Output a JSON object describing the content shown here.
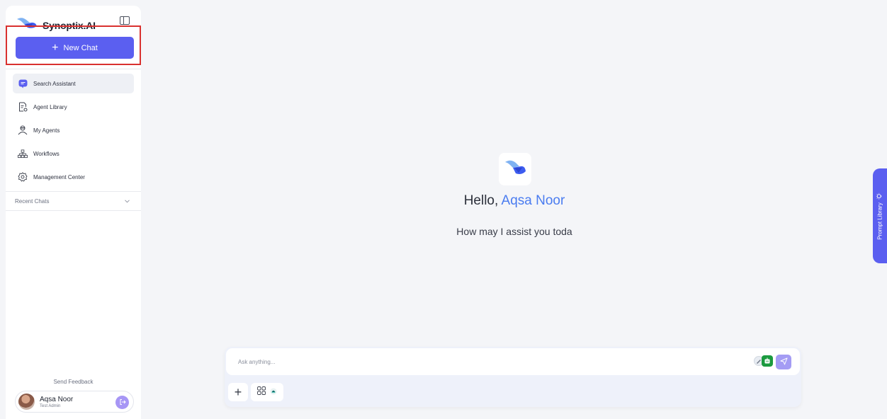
{
  "brand": {
    "name": "Synoptix.AI"
  },
  "sidebar": {
    "new_chat_label": "New Chat",
    "nav": [
      {
        "label": "Search Assistant",
        "icon": "chat-bubble-icon",
        "active": true
      },
      {
        "label": "Agent Library",
        "icon": "document-gear-icon"
      },
      {
        "label": "My Agents",
        "icon": "agent-person-icon"
      },
      {
        "label": "Workflows",
        "icon": "workflow-tree-icon"
      },
      {
        "label": "Management Center",
        "icon": "gear-icon"
      }
    ],
    "recent_chats_label": "Recent Chats",
    "feedback_label": "Send Feedback",
    "user": {
      "name": "Aqsa Noor",
      "role": "Test Admin"
    }
  },
  "main": {
    "greeting_prefix": "Hello, ",
    "greeting_name": "Aqsa Noor",
    "subtitle": "How may I assist you toda",
    "input_placeholder": "Ask anything...",
    "prompt_library_label": "Prompt Library"
  },
  "colors": {
    "accent": "#5b5ff0",
    "greeting_name": "#4a7cf0",
    "highlight_box": "#d9312f"
  }
}
